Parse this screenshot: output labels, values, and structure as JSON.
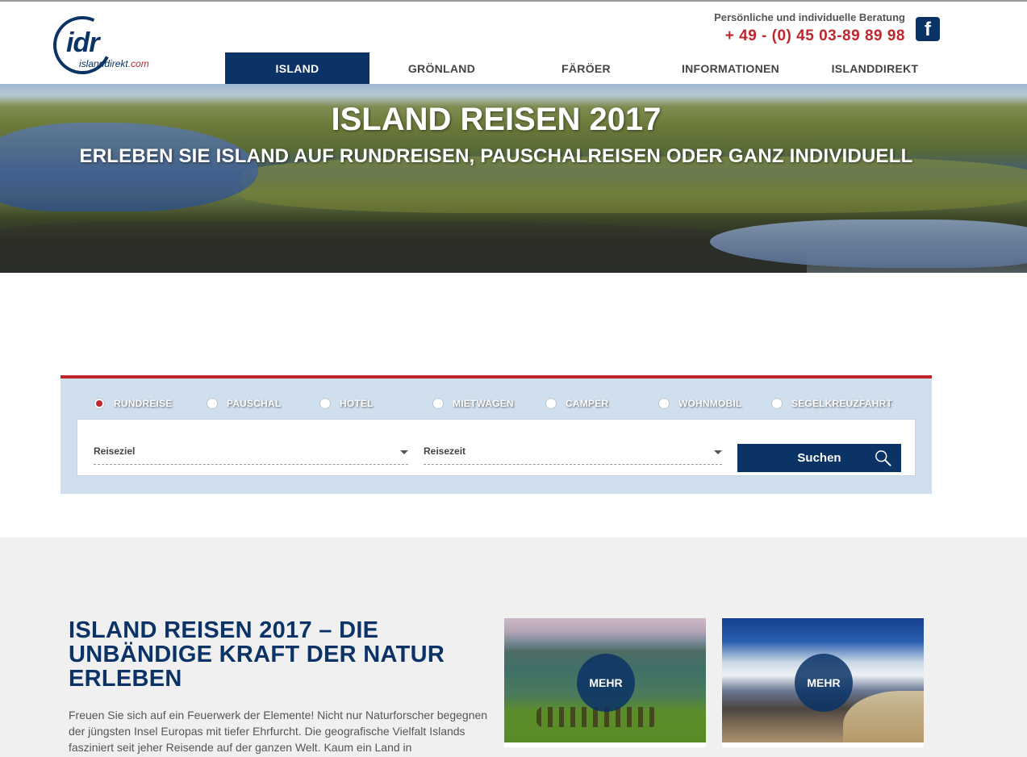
{
  "header": {
    "logo_text": "idr",
    "logo_sub": "islanddirekt",
    "logo_sub_tld": ".com",
    "consult_text": "Persönliche und individuelle Beratung",
    "phone": "+ 49 - (0) 45 03-89 89 98",
    "facebook_glyph": "f"
  },
  "nav": {
    "items": [
      {
        "label": "ISLAND",
        "active": true
      },
      {
        "label": "GRÖNLAND"
      },
      {
        "label": "FÄRÖER"
      },
      {
        "label": "INFORMATIONEN"
      },
      {
        "label": "ISLANDDIREKT"
      }
    ]
  },
  "hero": {
    "title": "ISLAND REISEN 2017",
    "subtitle": "ERLEBEN SIE ISLAND AUF RUNDREISEN, PAUSCHALREISEN ODER GANZ INDIVIDUELL"
  },
  "search": {
    "types": [
      {
        "label": "RUNDREISE",
        "checked": true
      },
      {
        "label": "PAUSCHAL"
      },
      {
        "label": "HOTEL"
      },
      {
        "label": "MIETWAGEN"
      },
      {
        "label": "CAMPER"
      },
      {
        "label": "WOHNMOBIL"
      },
      {
        "label": "SEGELKREUZFAHRT"
      }
    ],
    "destination_label": "Reiseziel",
    "time_label": "Reisezeit",
    "button_label": "Suchen"
  },
  "lower": {
    "title": "ISLAND REISEN 2017 – DIE UNBÄNDIGE KRAFT DER NATUR ERLEBEN",
    "text": "Freuen Sie sich auf ein Feuerwerk der Elemente! Nicht nur Naturforscher begegnen der jüngsten Insel Europas mit tiefer Ehrfurcht. Die geografische Vielfalt Islands fasziniert seit jeher Reisende auf der ganzen Welt. Kaum ein Land in",
    "cards": [
      {
        "button": "MEHR"
      },
      {
        "button": "MEHR"
      }
    ]
  },
  "colors": {
    "brand_blue": "#0b3366",
    "accent_red": "#c0272d",
    "search_bg": "#d0dfee"
  }
}
